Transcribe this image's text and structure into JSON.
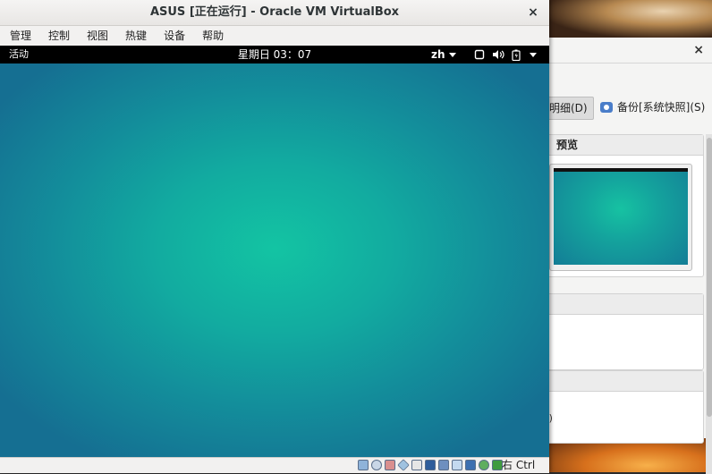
{
  "vm_window": {
    "title": "ASUS [正在运行] - Oracle VM VirtualBox",
    "close_glyph": "×",
    "menu": [
      "管理",
      "控制",
      "视图",
      "热键",
      "设备",
      "帮助"
    ],
    "guest_top_bar": {
      "activities": "活动",
      "clock": "星期日 03：07",
      "input_method": "zh",
      "icons": [
        "screen-icon",
        "volume-icon",
        "battery-icon",
        "system-menu-icon"
      ]
    },
    "status_bar": {
      "icons": [
        "hard-disk-icon",
        "optical-drive-icon",
        "audio-icon",
        "network-icon",
        "usb-icon",
        "shared-folder-icon",
        "display-icon",
        "video-capture-icon",
        "cpu-icon",
        "mouse-integration-icon",
        "keyboard-icon"
      ],
      "host_key": "右 Ctrl"
    }
  },
  "manager_window": {
    "close_glyph": "×",
    "toolbar": {
      "details": "明细(D)",
      "snapshots": "备份[系统快照](S)"
    },
    "preview_panel": {
      "header": "预览"
    },
    "partial_text": "R)"
  },
  "colors": {
    "guest_bg_center": "#13c4a3",
    "guest_bg_edge": "#156f92",
    "top_bar": "#000000"
  }
}
